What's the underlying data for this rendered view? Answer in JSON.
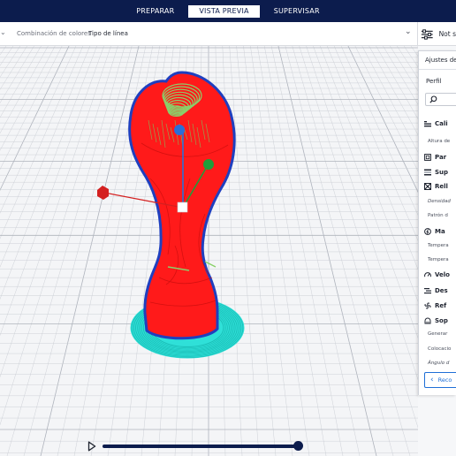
{
  "stages": [
    {
      "label": "PREPARAR",
      "active": false
    },
    {
      "label": "VISTA PREVIA",
      "active": true
    },
    {
      "label": "SUPERVISAR",
      "active": false
    }
  ],
  "toolbar": {
    "color_scheme_label": "Combinación de colores",
    "color_scheme_value": "Tipo de línea",
    "settings_label": "Not s"
  },
  "panel": {
    "header": "Ajustes de i",
    "profile_label": "Perfil",
    "rows": [
      {
        "kind": "cat",
        "icon": "quality-icon",
        "text": "Cali"
      },
      {
        "kind": "set",
        "text": "Altura de"
      },
      {
        "kind": "cat",
        "icon": "walls-icon",
        "text": "Par"
      },
      {
        "kind": "cat",
        "icon": "topbottom-icon",
        "text": "Sup"
      },
      {
        "kind": "cat",
        "icon": "infill-icon",
        "text": "Rell"
      },
      {
        "kind": "set",
        "italic": true,
        "text": "Densidad"
      },
      {
        "kind": "set",
        "text": "Patrón d"
      },
      {
        "kind": "cat",
        "icon": "material-icon",
        "text": "Ma"
      },
      {
        "kind": "set",
        "text": "Tempera"
      },
      {
        "kind": "set",
        "text": "Tempera"
      },
      {
        "kind": "cat",
        "icon": "speed-icon",
        "text": "Velo"
      },
      {
        "kind": "cat",
        "icon": "travel-icon",
        "text": "Des"
      },
      {
        "kind": "cat",
        "icon": "cooling-icon",
        "text": "Ref"
      },
      {
        "kind": "cat",
        "icon": "support-icon",
        "text": "Sop"
      },
      {
        "kind": "set",
        "text": "Generar"
      },
      {
        "kind": "set",
        "text": "Colocacio"
      },
      {
        "kind": "set",
        "italic": true,
        "text": "Ángulo d"
      }
    ],
    "recommended_label": "Reco"
  },
  "playback": {
    "progress": 1.0
  },
  "colors": {
    "nav": "#0c1c4d",
    "model": "#ff1a1a",
    "shell_outline": "#1f3fbf",
    "skirt": "#2fe0d8",
    "top_skin": "#8ad06a",
    "accent": "#1f6fd6"
  }
}
